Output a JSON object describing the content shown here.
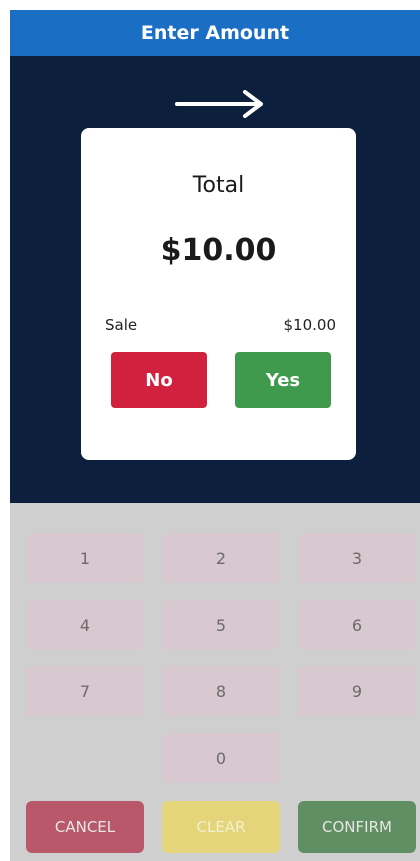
{
  "header": {
    "title": "Enter Amount"
  },
  "icons": {
    "arrow": "arrow-right-icon"
  },
  "card": {
    "title": "Total",
    "amount": "$10.00",
    "line_label": "Sale",
    "line_value": "$10.00",
    "no_label": "No",
    "yes_label": "Yes"
  },
  "keypad": {
    "keys": [
      "1",
      "2",
      "3",
      "4",
      "5",
      "6",
      "7",
      "8",
      "9",
      "0"
    ],
    "cancel_label": "CANCEL",
    "clear_label": "CLEAR",
    "confirm_label": "CONFIRM"
  },
  "colors": {
    "header": "#1a6fc4",
    "background": "#0c1f3d",
    "no": "#d2203f",
    "yes": "#3f9a4d"
  }
}
